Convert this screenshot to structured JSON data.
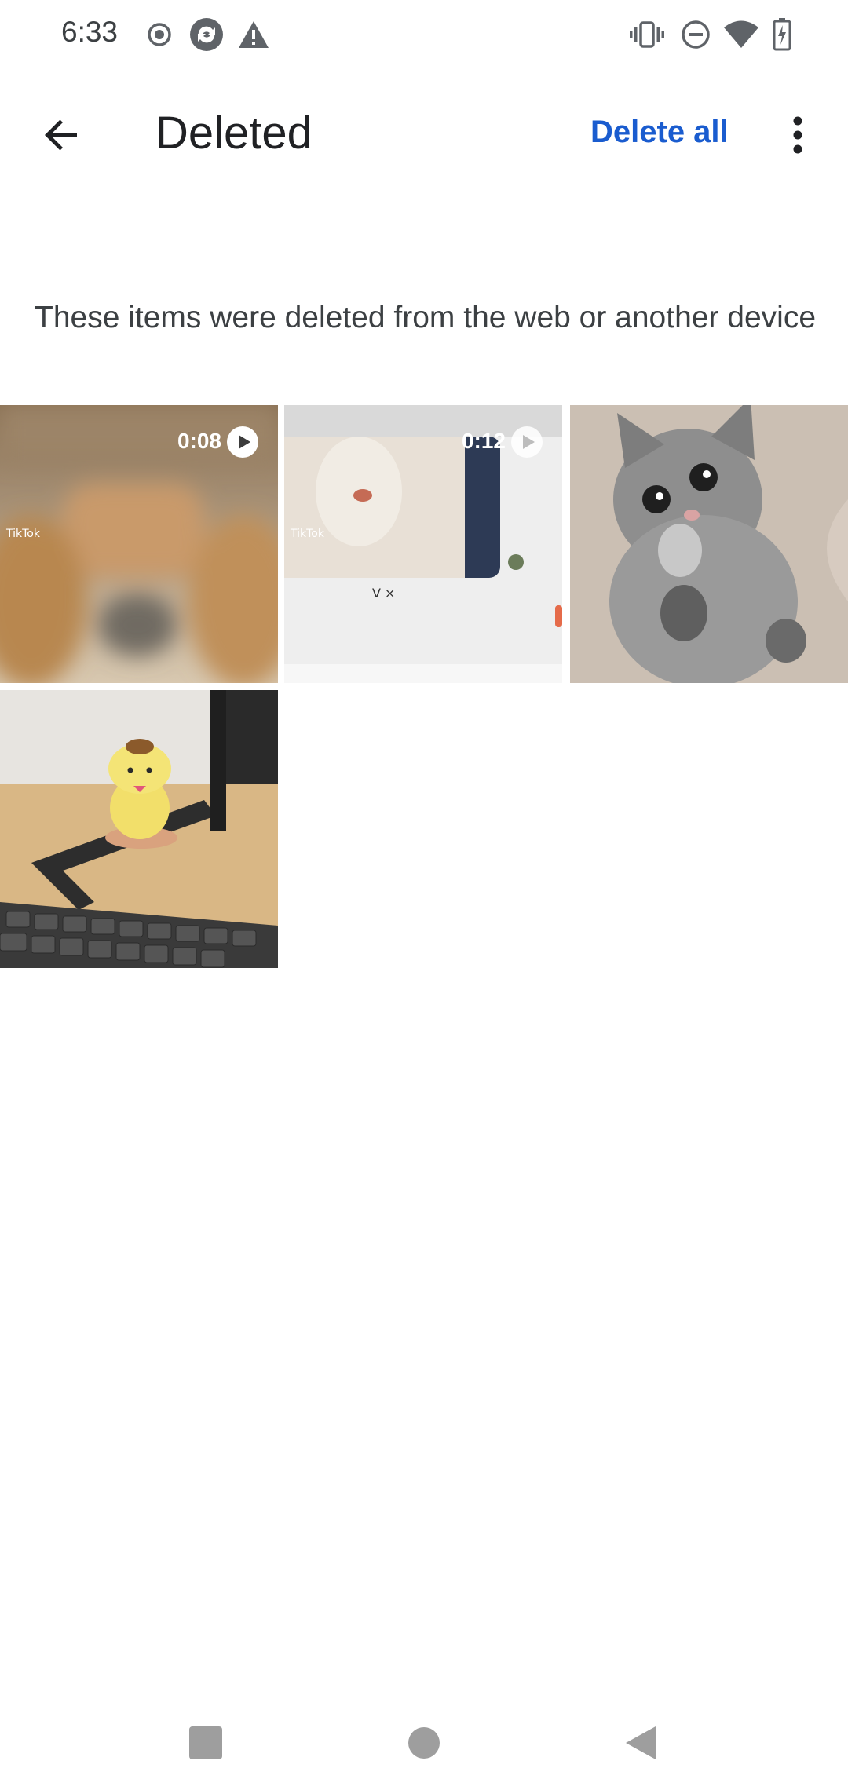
{
  "status_bar": {
    "time": "6:33",
    "left_icons": [
      "record-icon",
      "sync-icon",
      "warning-icon"
    ],
    "right_icons": [
      "vibrate-icon",
      "do-not-disturb-icon",
      "wifi-icon",
      "battery-charging-icon"
    ]
  },
  "app_bar": {
    "title": "Deleted",
    "delete_all_label": "Delete all",
    "back_icon": "arrow-back-icon",
    "more_icon": "more-vert-icon"
  },
  "info": {
    "text": "These items were deleted from the web or another device"
  },
  "items": [
    {
      "type": "video",
      "duration": "0:08",
      "thumb": "blurred teddy bear video"
    },
    {
      "type": "video",
      "duration": "0:12",
      "thumb": "tiktok portrait video"
    },
    {
      "type": "photo",
      "thumb": "grey kitten"
    },
    {
      "type": "photo",
      "thumb": "yellow figurine on desk with keyboard"
    }
  ],
  "nav_bar": {
    "icons": [
      "recents-square-icon",
      "home-circle-icon",
      "back-triangle-icon"
    ]
  },
  "colors": {
    "accent": "#1a5ccf",
    "background": "#ffffff",
    "nav_icon": "#9e9e9e"
  }
}
